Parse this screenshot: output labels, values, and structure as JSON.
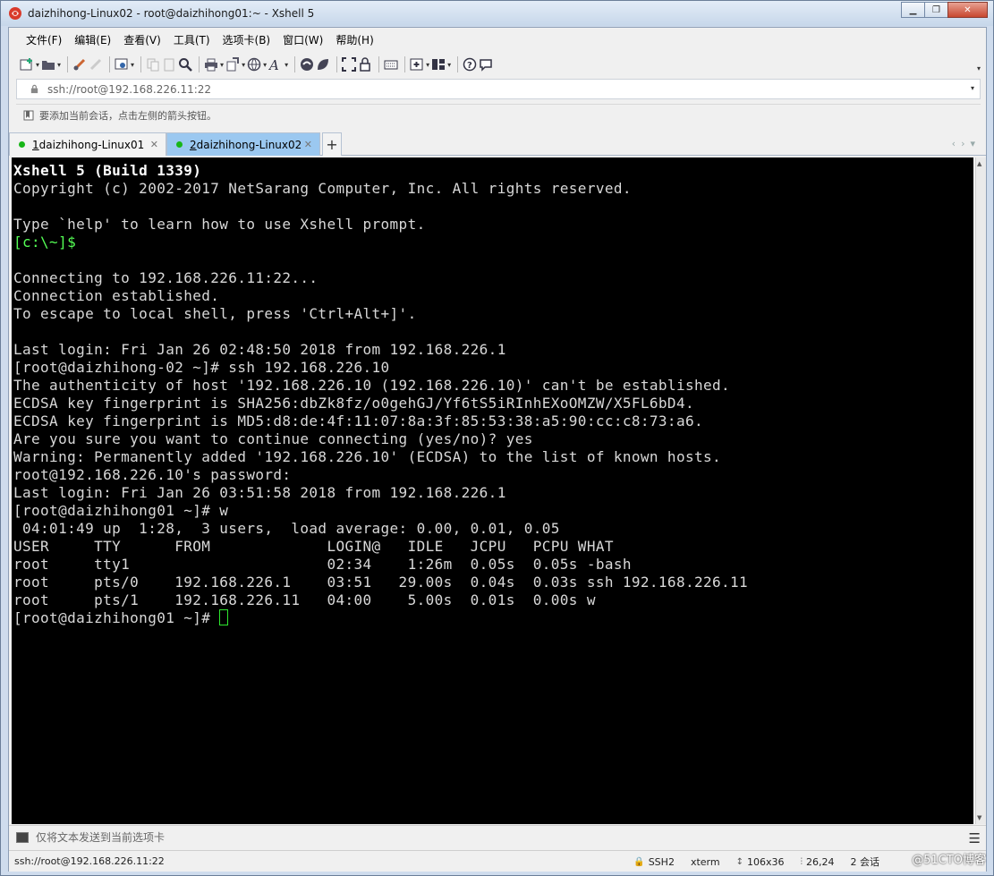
{
  "window": {
    "title": "daizhihong-Linux02 - root@daizhihong01:~ - Xshell 5"
  },
  "menu": [
    "文件(F)",
    "编辑(E)",
    "查看(V)",
    "工具(T)",
    "选项卡(B)",
    "窗口(W)",
    "帮助(H)"
  ],
  "toolbar_icons": [
    "new-session-icon",
    "open-folder-icon",
    "reconnect-icon",
    "disconnect-icon",
    "properties-icon",
    "copy-icon",
    "paste-icon",
    "find-icon",
    "print-icon",
    "transfer-icon",
    "globe-icon",
    "font-icon",
    "xftp-icon",
    "xagent-icon",
    "fullscreen-icon",
    "lock-icon",
    "keyboard-icon",
    "add-tab-icon",
    "layout-icon",
    "help-icon",
    "chat-icon"
  ],
  "address": {
    "value": "ssh://root@192.168.226.11:22"
  },
  "hint": {
    "text": "要添加当前会话，点击左侧的箭头按钮。"
  },
  "tabs": [
    {
      "num": "1",
      "label": " daizhihong-Linux01",
      "active": false
    },
    {
      "num": "2",
      "label": " daizhihong-Linux02",
      "active": true
    }
  ],
  "terminal": {
    "lines": [
      {
        "text": "Xshell 5 (Build 1339)",
        "style": "bold"
      },
      {
        "text": "Copyright (c) 2002-2017 NetSarang Computer, Inc. All rights reserved.",
        "style": "normal"
      },
      {
        "text": "",
        "style": "normal"
      },
      {
        "text": "Type `help' to learn how to use Xshell prompt.",
        "style": "normal"
      },
      {
        "text": "[c:\\~]$",
        "style": "green"
      },
      {
        "text": "",
        "style": "normal"
      },
      {
        "text": "Connecting to 192.168.226.11:22...",
        "style": "normal"
      },
      {
        "text": "Connection established.",
        "style": "normal"
      },
      {
        "text": "To escape to local shell, press 'Ctrl+Alt+]'.",
        "style": "normal"
      },
      {
        "text": "",
        "style": "normal"
      },
      {
        "text": "Last login: Fri Jan 26 02:48:50 2018 from 192.168.226.1",
        "style": "normal"
      },
      {
        "text": "[root@daizhihong-02 ~]# ssh 192.168.226.10",
        "style": "normal"
      },
      {
        "text": "The authenticity of host '192.168.226.10 (192.168.226.10)' can't be established.",
        "style": "normal"
      },
      {
        "text": "ECDSA key fingerprint is SHA256:dbZk8fz/o0gehGJ/Yf6tS5iRInhEXoOMZW/X5FL6bD4.",
        "style": "normal"
      },
      {
        "text": "ECDSA key fingerprint is MD5:d8:de:4f:11:07:8a:3f:85:53:38:a5:90:cc:c8:73:a6.",
        "style": "normal"
      },
      {
        "text": "Are you sure you want to continue connecting (yes/no)? yes",
        "style": "normal"
      },
      {
        "text": "Warning: Permanently added '192.168.226.10' (ECDSA) to the list of known hosts.",
        "style": "normal"
      },
      {
        "text": "root@192.168.226.10's password:",
        "style": "normal"
      },
      {
        "text": "Last login: Fri Jan 26 03:51:58 2018 from 192.168.226.1",
        "style": "normal"
      },
      {
        "text": "[root@daizhihong01 ~]# w",
        "style": "normal"
      },
      {
        "text": " 04:01:49 up  1:28,  3 users,  load average: 0.00, 0.01, 0.05",
        "style": "normal"
      },
      {
        "text": "USER     TTY      FROM             LOGIN@   IDLE   JCPU   PCPU WHAT",
        "style": "normal"
      },
      {
        "text": "root     tty1                      02:34    1:26m  0.05s  0.05s -bash",
        "style": "normal"
      },
      {
        "text": "root     pts/0    192.168.226.1    03:51   29.00s  0.04s  0.03s ssh 192.168.226.11",
        "style": "normal"
      },
      {
        "text": "root     pts/1    192.168.226.11   04:00    5.00s  0.01s  0.00s w",
        "style": "normal"
      }
    ],
    "prompt": "[root@daizhihong01 ~]# "
  },
  "compose": {
    "placeholder": "仅将文本发送到当前选项卡"
  },
  "status": {
    "connection": "ssh://root@192.168.226.11:22",
    "protocol": "SSH2",
    "term": "xterm",
    "size": "106x36",
    "cursor": "26,24",
    "sessions": "2 会话"
  },
  "watermark": "@51CTO博客",
  "colors": {
    "terminal_bg": "#000000",
    "terminal_fg": "#d8d8d8",
    "prompt_green": "#55ff55",
    "active_tab": "#9bc8f0",
    "status_dot": "#18b618"
  }
}
